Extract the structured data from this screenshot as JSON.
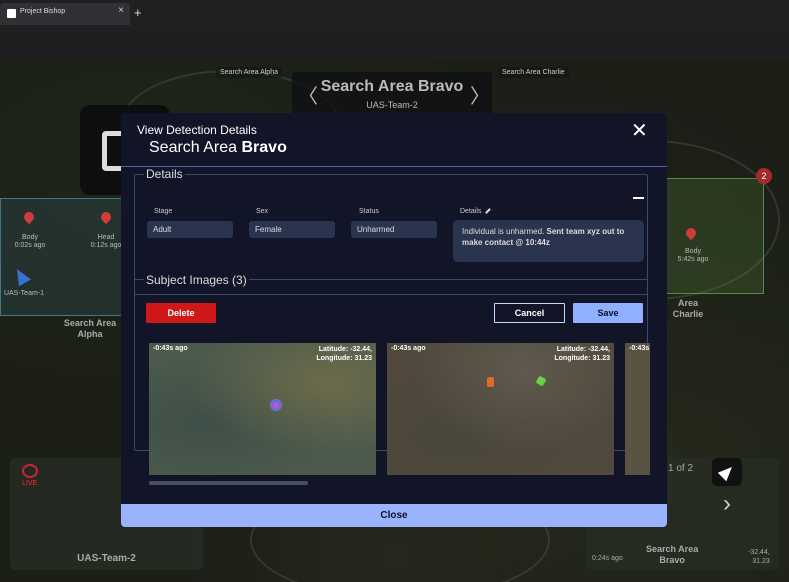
{
  "browser": {
    "tab_title": "Project Bishop",
    "tab_close": "×",
    "new_tab": "+"
  },
  "map": {
    "area_chip_left": "Search Area Alpha",
    "area_chip_right": "Search Area Charlie",
    "area_nav_title": "Search Area Bravo",
    "area_nav_team": "UAS-Team-2",
    "prev_symbol": "〈",
    "next_symbol": "〉",
    "markers": [
      {
        "type": "Body",
        "time": "0:02s ago"
      },
      {
        "type": "Head",
        "time": "0:12s ago"
      },
      {
        "type": "Body",
        "time": "5:42s ago"
      }
    ],
    "uas_team_1": "UAS-Team-1",
    "area_alpha_label": "Search Area\nAlpha",
    "area_charlie_label": "Area\nCharlie",
    "charlie_count": "2",
    "live_label": "LIVE",
    "cam_left_name": "UAS-Team-2",
    "page_count": "1 of 2",
    "cam_right_time": "0:24s ago",
    "cam_right_area": "Search Area\nBravo",
    "cam_right_coords": "-32.44,\n31.23",
    "next_chevron": "›"
  },
  "modal": {
    "title": "View Detection Details",
    "subtitle_prefix": "Search Area ",
    "subtitle_bold": "Bravo",
    "close_symbol": "✕",
    "details_legend": "Details",
    "fields": {
      "stage_label": "Stage",
      "stage_value": "Adult",
      "sex_label": "Sex",
      "sex_value": "Female",
      "status_label": "Status",
      "status_value": "Unharmed",
      "details_label": "Details"
    },
    "notes_plain": "Individual is unharmed. ",
    "notes_bold": "Sent team xyz out to make contact @ 10:44z",
    "images_title": "Subject Images (3)",
    "delete_label": "Delete",
    "cancel_label": "Cancel",
    "save_label": "Save",
    "photos": [
      {
        "time": "-0:43s ago",
        "lat": "Latitude: -32.44,",
        "lon": "Longitude:    31.23"
      },
      {
        "time": "-0:43s ago",
        "lat": "Latitude: -32.44,",
        "lon": "Longitude:    31.23"
      },
      {
        "time": "-0:43s"
      }
    ],
    "close_bar_label": "Close"
  }
}
